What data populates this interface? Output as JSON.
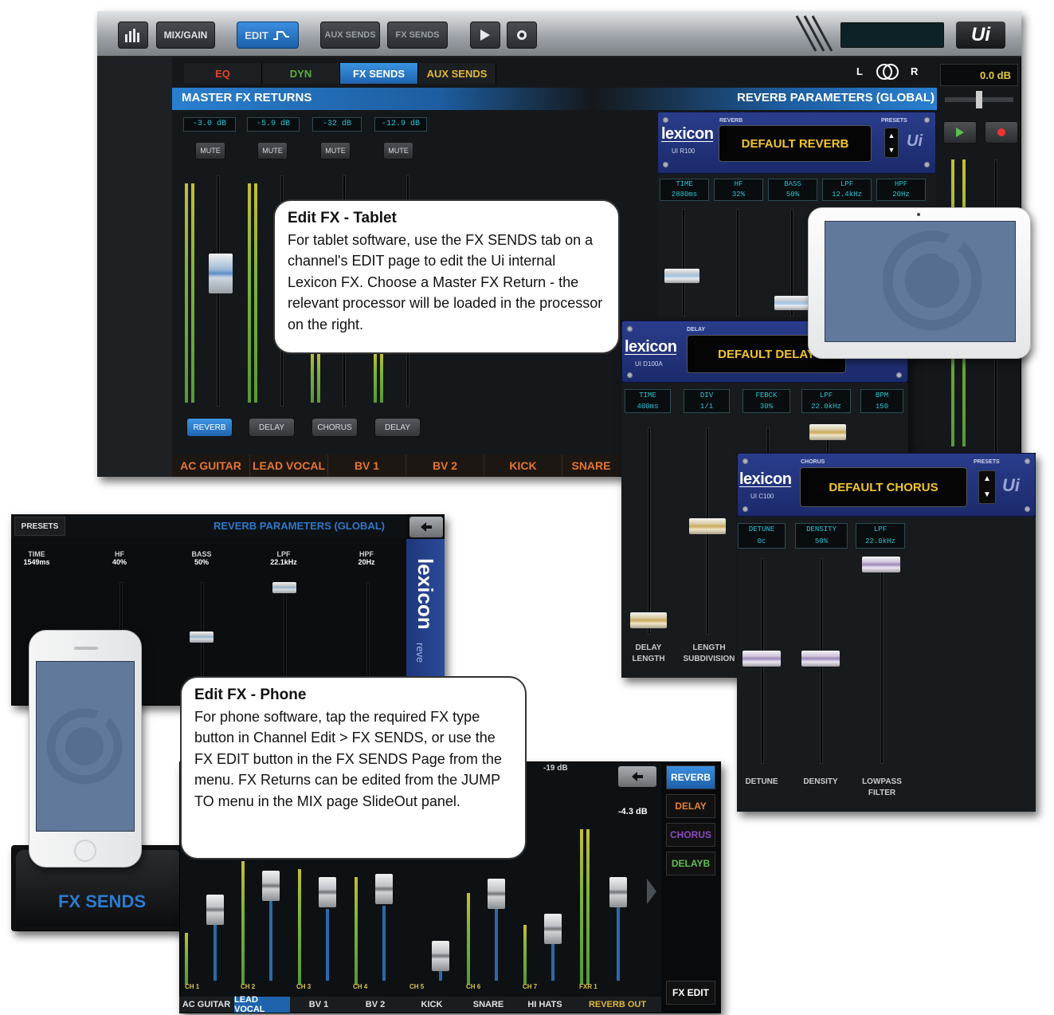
{
  "tablet": {
    "toolbar": {
      "mix_gain": "MIX/GAIN",
      "edit": "EDIT",
      "aux_sends": "AUX SENDS",
      "fx_sends": "FX SENDS",
      "logo": "Ui"
    },
    "tabs": [
      "EQ",
      "DYN",
      "FX SENDS",
      "AUX SENDS"
    ],
    "lr": {
      "left": "L",
      "right": "R"
    },
    "master_level": "0.0 dB",
    "section_title": "MASTER FX RETURNS",
    "reverb_title": "REVERB PARAMETERS (GLOBAL)",
    "returns": [
      {
        "level": "-3.0 dB",
        "mute": "MUTE",
        "fx": "REVERB"
      },
      {
        "level": "-5.9 dB",
        "mute": "MUTE",
        "fx": "DELAY"
      },
      {
        "level": "-32 dB",
        "mute": "MUTE",
        "fx": "CHORUS"
      },
      {
        "level": "-12.9 dB",
        "mute": "MUTE",
        "fx": "DELAY"
      }
    ],
    "channels": [
      "AC GUITAR",
      "LEAD VOCAL",
      "BV 1",
      "BV 2",
      "KICK",
      "SNARE"
    ]
  },
  "reverb_unit": {
    "brand": "lexicon",
    "model": "UI R100",
    "tag": "REVERB",
    "presets_label": "PRESETS",
    "display": "DEFAULT REVERB",
    "params": [
      {
        "name": "TIME",
        "value": "2880ms"
      },
      {
        "name": "HF",
        "value": "32%"
      },
      {
        "name": "BASS",
        "value": "50%"
      },
      {
        "name": "LPF",
        "value": "12.4kHz"
      },
      {
        "name": "HPF",
        "value": "20Hz"
      }
    ]
  },
  "delay_unit": {
    "brand": "lexicon",
    "model": "UI D100A",
    "tag": "DELAY",
    "display": "DEFAULT DELAY",
    "params": [
      {
        "name": "TIME",
        "value": "400ms"
      },
      {
        "name": "DIV",
        "value": "1/1"
      },
      {
        "name": "FEBCK",
        "value": "30%"
      },
      {
        "name": "LPF",
        "value": "22.0kHz"
      },
      {
        "name": "BPM",
        "value": "150"
      }
    ],
    "fader_labels": [
      "DELAY LENGTH",
      "LENGTH SUBDIVISION"
    ]
  },
  "chorus_unit": {
    "brand": "lexicon",
    "model": "UI C100",
    "tag": "CHORUS",
    "presets_label": "PRESETS",
    "display": "DEFAULT CHORUS",
    "params": [
      {
        "name": "DETUNE",
        "value": "0c"
      },
      {
        "name": "DENSITY",
        "value": "50%"
      },
      {
        "name": "LPF",
        "value": "22.0kHz"
      }
    ],
    "fader_labels": [
      "DETUNE",
      "DENSITY",
      "LOWPASS FILTER"
    ]
  },
  "tablet_bubble": {
    "title": "Edit FX - Tablet",
    "text": "For tablet software, use the FX SENDS tab on a channel's EDIT page to edit the Ui internal Lexicon FX. Choose a Master FX Return - the relevant processor will be loaded in the processor on the right."
  },
  "phone_params": {
    "presets": "PRESETS",
    "title": "REVERB PARAMETERS (GLOBAL)",
    "brand": "lexicon",
    "brand_sub": "reve",
    "params": [
      {
        "name": "TIME",
        "value": "1549ms"
      },
      {
        "name": "HF",
        "value": "40%"
      },
      {
        "name": "BASS",
        "value": "50%"
      },
      {
        "name": "LPF",
        "value": "22.1kHz"
      },
      {
        "name": "HPF",
        "value": "20Hz"
      }
    ]
  },
  "phone_bubble": {
    "title": "Edit FX - Phone",
    "text": "For phone software, tap the required FX type button in Channel Edit > FX SENDS, or use the FX EDIT button in the FX SENDS Page from the menu. FX Returns can be edited from the JUMP TO menu in the MIX page SlideOut panel."
  },
  "phone_menu": {
    "label": "FX SENDS"
  },
  "phone_mixer": {
    "top_level": "-19 dB",
    "right_level": "-4.3 dB",
    "fx_buttons": [
      "REVERB",
      "DELAY",
      "CHORUS",
      "DELAYB"
    ],
    "fx_colors": [
      "#4aa8e8",
      "#e6802d",
      "#8a4bbf",
      "#5ec04a"
    ],
    "fx_edit": "FX EDIT",
    "channels": [
      {
        "num": "CH 1",
        "name": "AC GUITAR"
      },
      {
        "num": "CH 2",
        "name": "LEAD VOCAL"
      },
      {
        "num": "CH 3",
        "name": "BV 1"
      },
      {
        "num": "CH 4",
        "name": "BV 2"
      },
      {
        "num": "CH 5",
        "name": "KICK"
      },
      {
        "num": "CH 6",
        "name": "SNARE"
      },
      {
        "num": "CH 7",
        "name": "HI HATS"
      },
      {
        "num": "FXR 1",
        "name": "REVERB OUT"
      }
    ]
  },
  "colors": {
    "accent_blue": "#2a7fd0",
    "eq_tab": "#e0442b",
    "dyn_tab": "#5ab03c",
    "aux_tab": "#e1b83a",
    "channel_orange": "#e4762f",
    "lexicon_blue": "#1f2f78",
    "display_yellow": "#f3c52b"
  }
}
